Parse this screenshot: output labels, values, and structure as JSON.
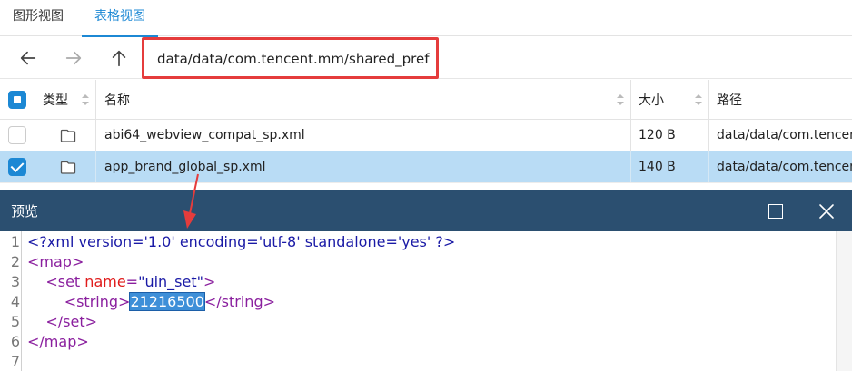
{
  "tabs": [
    {
      "label": "图形视图",
      "active": false
    },
    {
      "label": "表格视图",
      "active": true
    }
  ],
  "toolbar": {
    "path_value": "data/data/com.tencent.mm/shared_prefs",
    "highlight_color": "#e53c3c"
  },
  "table": {
    "headers": {
      "type": "类型",
      "name": "名称",
      "size": "大小",
      "path": "路径"
    },
    "rows": [
      {
        "type_icon": "file-icon",
        "name": "abi64_webview_compat_sp.xml",
        "size": "120 B",
        "path": "data/data/com.tencent.mm/shared_prefs",
        "checked": false
      },
      {
        "type_icon": "file-icon",
        "name": "app_brand_global_sp.xml",
        "size": "140 B",
        "path": "data/data/com.tencent.mm/shared_prefs",
        "checked": true
      }
    ],
    "selected_row_color": "#b9dcf5"
  },
  "preview": {
    "title": "预览",
    "titlebar_color": "#2b4f70",
    "line_numbers": [
      "1",
      "2",
      "3",
      "4",
      "5",
      "6",
      "7"
    ],
    "lines": {
      "l1": "<?xml version='1.0' encoding='utf-8' standalone='yes' ?>",
      "l2": "<map>",
      "l3_open": "    <set ",
      "l3_attr": "name",
      "l3_eq": "=",
      "l3_val": "\"uin_set\"",
      "l3_close": ">",
      "l4_open": "        <string>",
      "l4_value": "21216500",
      "l4_close": "</string>",
      "l5": "    </set>",
      "l6": "</map>"
    }
  }
}
